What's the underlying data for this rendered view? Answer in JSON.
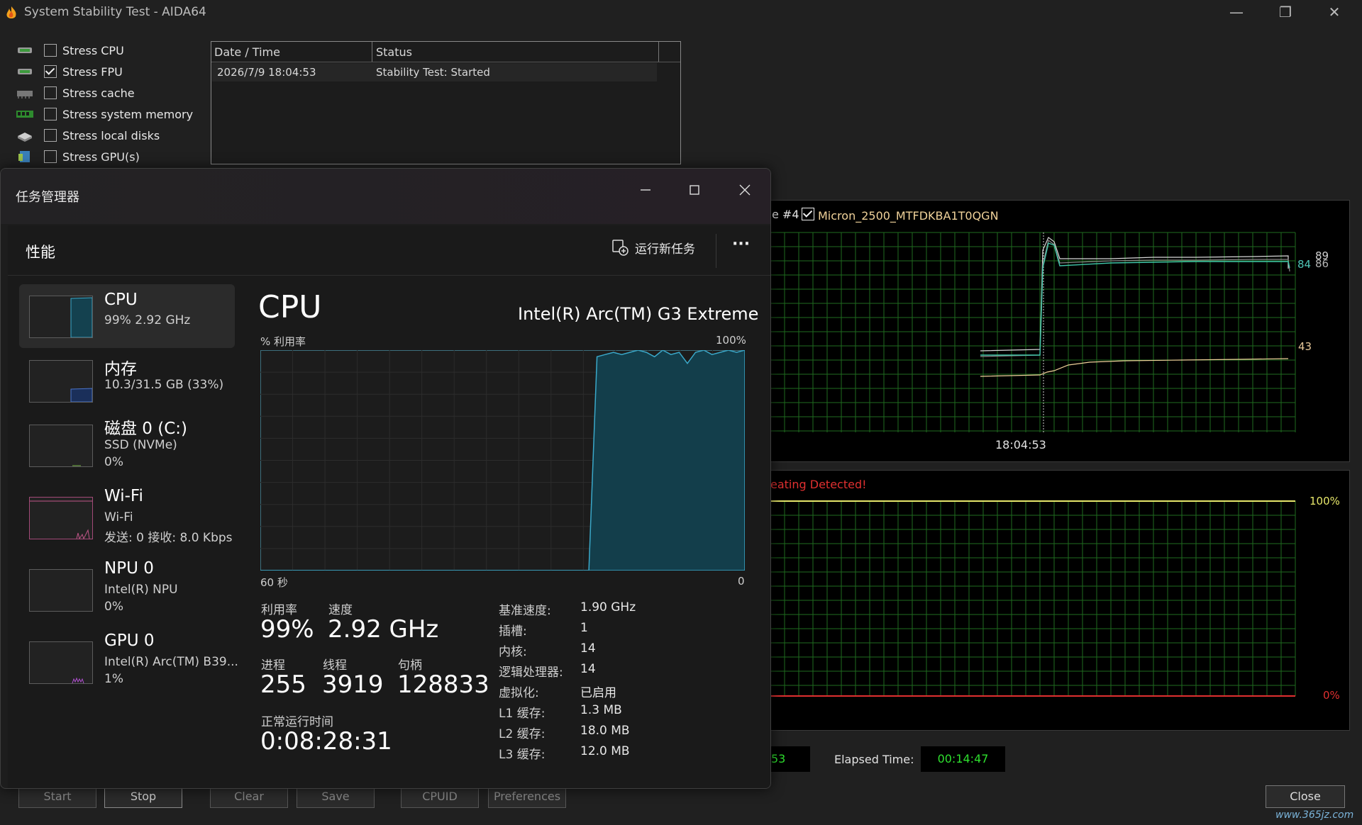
{
  "aida": {
    "title": "System Stability Test - AIDA64",
    "window_controls": {
      "minimize": "—",
      "restore": "❐",
      "close": "✕"
    },
    "stress_options": [
      {
        "label": "Stress CPU",
        "checked": false,
        "icon": "cpu-chip-icon"
      },
      {
        "label": "Stress FPU",
        "checked": true,
        "icon": "fpu-chip-icon"
      },
      {
        "label": "Stress cache",
        "checked": false,
        "icon": "cache-icon"
      },
      {
        "label": "Stress system memory",
        "checked": false,
        "icon": "memory-icon"
      },
      {
        "label": "Stress local disks",
        "checked": false,
        "icon": "disk-icon"
      },
      {
        "label": "Stress GPU(s)",
        "checked": false,
        "icon": "gpu-icon"
      }
    ],
    "log": {
      "col_datetime": "Date / Time",
      "col_status": "Status",
      "rows": [
        {
          "datetime": "2026/7/9 18:04:53",
          "status": "Stability Test: Started"
        }
      ]
    },
    "temp_graph": {
      "legend_partial": "e #4",
      "disk_label": "Micron_2500_MTFDKBA1T0QGN",
      "disk_checked": true,
      "values": {
        "v89": "89",
        "v86": "86",
        "v84": "84",
        "v43": "43"
      },
      "time_label": "18:04:53"
    },
    "usage_graph": {
      "alert": "eating Detected!",
      "top_label": "100%",
      "bottom_label": "0%"
    },
    "clock_partial": "53",
    "elapsed_label": "Elapsed Time:",
    "elapsed_value": "00:14:47",
    "buttons": {
      "start": "Start",
      "stop": "Stop",
      "clear": "Clear",
      "save": "Save",
      "cpuid": "CPUID",
      "preferences": "Preferences",
      "close": "Close"
    },
    "watermark": "www.365jz.com"
  },
  "tm": {
    "title": "任务管理器",
    "section": "性能",
    "run_task": "运行新任务",
    "more": "···",
    "sidebar": [
      {
        "title": "CPU",
        "sub1": "99%  2.92 GHz",
        "sub2": ""
      },
      {
        "title": "内存",
        "sub1": "10.3/31.5 GB (33%)",
        "sub2": ""
      },
      {
        "title": "磁盘 0 (C:)",
        "sub1": "SSD (NVMe)",
        "sub2": "0%"
      },
      {
        "title": "Wi-Fi",
        "sub1": "Wi-Fi",
        "sub2": "发送: 0 接收: 8.0 Kbps"
      },
      {
        "title": "NPU 0",
        "sub1": "Intel(R) NPU",
        "sub2": "0%"
      },
      {
        "title": "GPU 0",
        "sub1": "Intel(R) Arc(TM) B39...",
        "sub2": "1%"
      }
    ],
    "cpu": {
      "heading": "CPU",
      "model": "Intel(R) Arc(TM) G3 Extreme",
      "util_label": "% 利用率",
      "max_label": "100%",
      "time_left": "60 秒",
      "time_right": "0",
      "util_history_pct": [
        0,
        0,
        0,
        0,
        0,
        0,
        0,
        0,
        0,
        0,
        0,
        0,
        0,
        0,
        0,
        0,
        0,
        0,
        0,
        0,
        0,
        0,
        0,
        0,
        0,
        0,
        0,
        0,
        0,
        0,
        0,
        0,
        0,
        0,
        0,
        0,
        0,
        0,
        0,
        0,
        0,
        97,
        98,
        99,
        98,
        99,
        100,
        99,
        97,
        100,
        98,
        99,
        94,
        99,
        100,
        98,
        99,
        100,
        99,
        100
      ],
      "stats": {
        "util_label": "利用率",
        "util_value": "99%",
        "speed_label": "速度",
        "speed_value": "2.92 GHz",
        "proc_label": "进程",
        "proc_value": "255",
        "thread_label": "线程",
        "thread_value": "3919",
        "handle_label": "句柄",
        "handle_value": "128833",
        "uptime_label": "正常运行时间",
        "uptime_value": "0:08:28:31"
      },
      "specs": [
        {
          "k": "基准速度:",
          "v": "1.90 GHz"
        },
        {
          "k": "插槽:",
          "v": "1"
        },
        {
          "k": "内核:",
          "v": "14"
        },
        {
          "k": "逻辑处理器:",
          "v": "14"
        },
        {
          "k": "虚拟化:",
          "v": "已启用"
        },
        {
          "k": "L1 缓存:",
          "v": "1.3 MB"
        },
        {
          "k": "L2 缓存:",
          "v": "18.0 MB"
        },
        {
          "k": "L3 缓存:",
          "v": "12.0 MB"
        }
      ]
    }
  }
}
